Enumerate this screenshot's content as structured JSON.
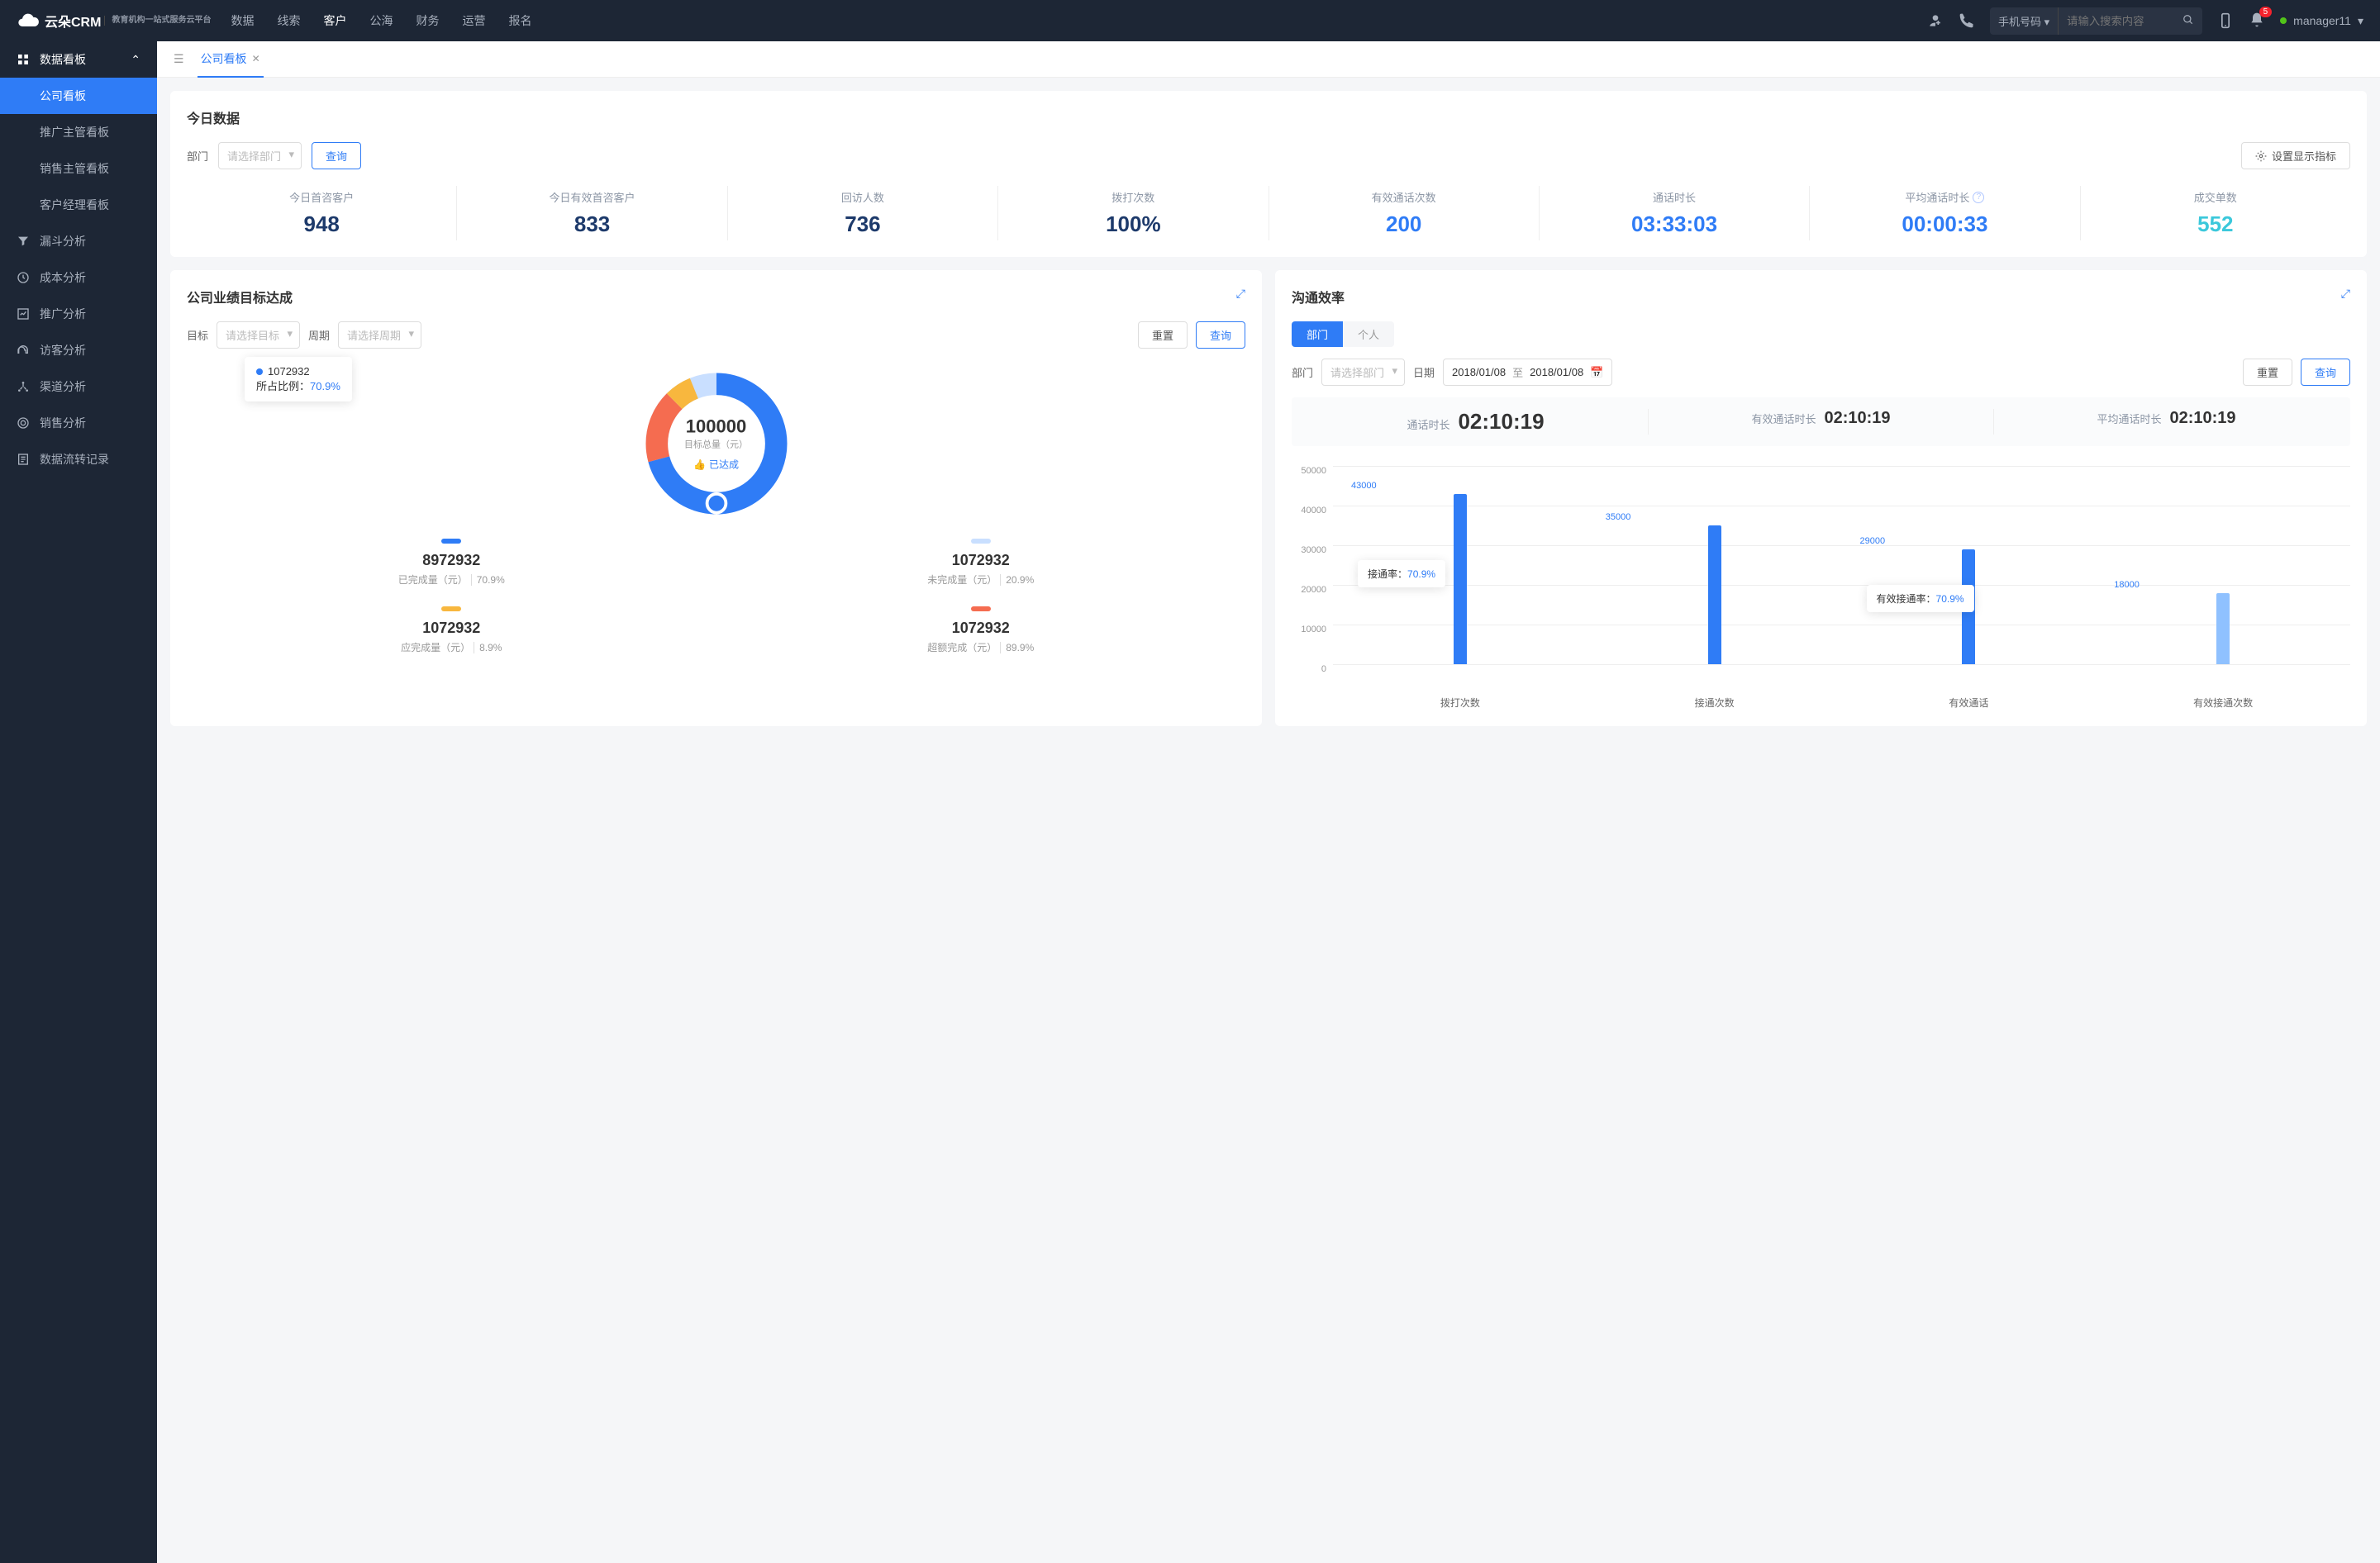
{
  "header": {
    "logo_text": "云朵CRM",
    "logo_sub": "教育机构一站式服务云平台",
    "nav": [
      "数据",
      "线索",
      "客户",
      "公海",
      "财务",
      "运营",
      "报名"
    ],
    "nav_active": 2,
    "search_type": "手机号码",
    "search_placeholder": "请输入搜索内容",
    "badge": "5",
    "user": "manager11"
  },
  "sidebar": {
    "group": "数据看板",
    "items": [
      "公司看板",
      "推广主管看板",
      "销售主管看板",
      "客户经理看板"
    ],
    "active": 0,
    "menu": [
      {
        "label": "漏斗分析",
        "icon": "funnel"
      },
      {
        "label": "成本分析",
        "icon": "clock"
      },
      {
        "label": "推广分析",
        "icon": "chart"
      },
      {
        "label": "访客分析",
        "icon": "headset"
      },
      {
        "label": "渠道分析",
        "icon": "network"
      },
      {
        "label": "销售分析",
        "icon": "target"
      },
      {
        "label": "数据流转记录",
        "icon": "log"
      }
    ]
  },
  "tabs": {
    "active": "公司看板"
  },
  "today": {
    "title": "今日数据",
    "dept_label": "部门",
    "dept_placeholder": "请选择部门",
    "query": "查询",
    "settings": "设置显示指标",
    "stats": [
      {
        "label": "今日首咨客户",
        "value": "948",
        "cls": "c-dblue"
      },
      {
        "label": "今日有效首咨客户",
        "value": "833",
        "cls": "c-dblue"
      },
      {
        "label": "回访人数",
        "value": "736",
        "cls": "c-dblue"
      },
      {
        "label": "拨打次数",
        "value": "100%",
        "cls": "c-dblue"
      },
      {
        "label": "有效通话次数",
        "value": "200",
        "cls": "c-blue"
      },
      {
        "label": "通话时长",
        "value": "03:33:03",
        "cls": "c-blue"
      },
      {
        "label": "平均通话时长",
        "value": "00:00:33",
        "cls": "c-blue",
        "info": true
      },
      {
        "label": "成交单数",
        "value": "552",
        "cls": "c-cyan"
      }
    ]
  },
  "goal": {
    "title": "公司业绩目标达成",
    "target_label": "目标",
    "target_placeholder": "请选择目标",
    "period_label": "周期",
    "period_placeholder": "请选择周期",
    "reset": "重置",
    "query": "查询",
    "tooltip_value": "1072932",
    "tooltip_ratio_label": "所占比例：",
    "tooltip_ratio": "70.9%",
    "center_value": "100000",
    "center_sub": "目标总量（元）",
    "achieved": "已达成",
    "metrics": [
      {
        "color": "#2f7cf6",
        "value": "8972932",
        "label": "已完成量（元）",
        "pct": "70.9%"
      },
      {
        "color": "#c9dfff",
        "value": "1072932",
        "label": "未完成量（元）",
        "pct": "20.9%"
      },
      {
        "color": "#f8b73e",
        "value": "1072932",
        "label": "应完成量（元）",
        "pct": "8.9%"
      },
      {
        "color": "#f56c50",
        "value": "1072932",
        "label": "超额完成（元）",
        "pct": "89.9%"
      }
    ]
  },
  "eff": {
    "title": "沟通效率",
    "pill_dept": "部门",
    "pill_person": "个人",
    "dept_label": "部门",
    "dept_placeholder": "请选择部门",
    "date_label": "日期",
    "date_from": "2018/01/08",
    "date_to": "至",
    "date_end": "2018/01/08",
    "reset": "重置",
    "query": "查询",
    "summary": [
      {
        "label": "通话时长",
        "value": "02:10:19",
        "big": true
      },
      {
        "label": "有效通话时长",
        "value": "02:10:19"
      },
      {
        "label": "平均通话时长",
        "value": "02:10:19"
      }
    ],
    "tooltip1_label": "接通率：",
    "tooltip1_val": "70.9%",
    "tooltip2_label": "有效接通率：",
    "tooltip2_val": "70.9%"
  },
  "chart_data": {
    "type": "bar",
    "ylim": [
      0,
      50000
    ],
    "yticks": [
      0,
      10000,
      20000,
      30000,
      40000,
      50000
    ],
    "categories": [
      "拨打次数",
      "接通次数",
      "有效通话",
      "有效接通次数"
    ],
    "values": [
      43000,
      35000,
      29000,
      18000
    ],
    "alt_bar_index": 3,
    "tooltips": [
      {
        "after_index": 0,
        "label": "接通率：",
        "value": "70.9%"
      },
      {
        "after_index": 2,
        "label": "有效接通率：",
        "value": "70.9%"
      }
    ]
  }
}
